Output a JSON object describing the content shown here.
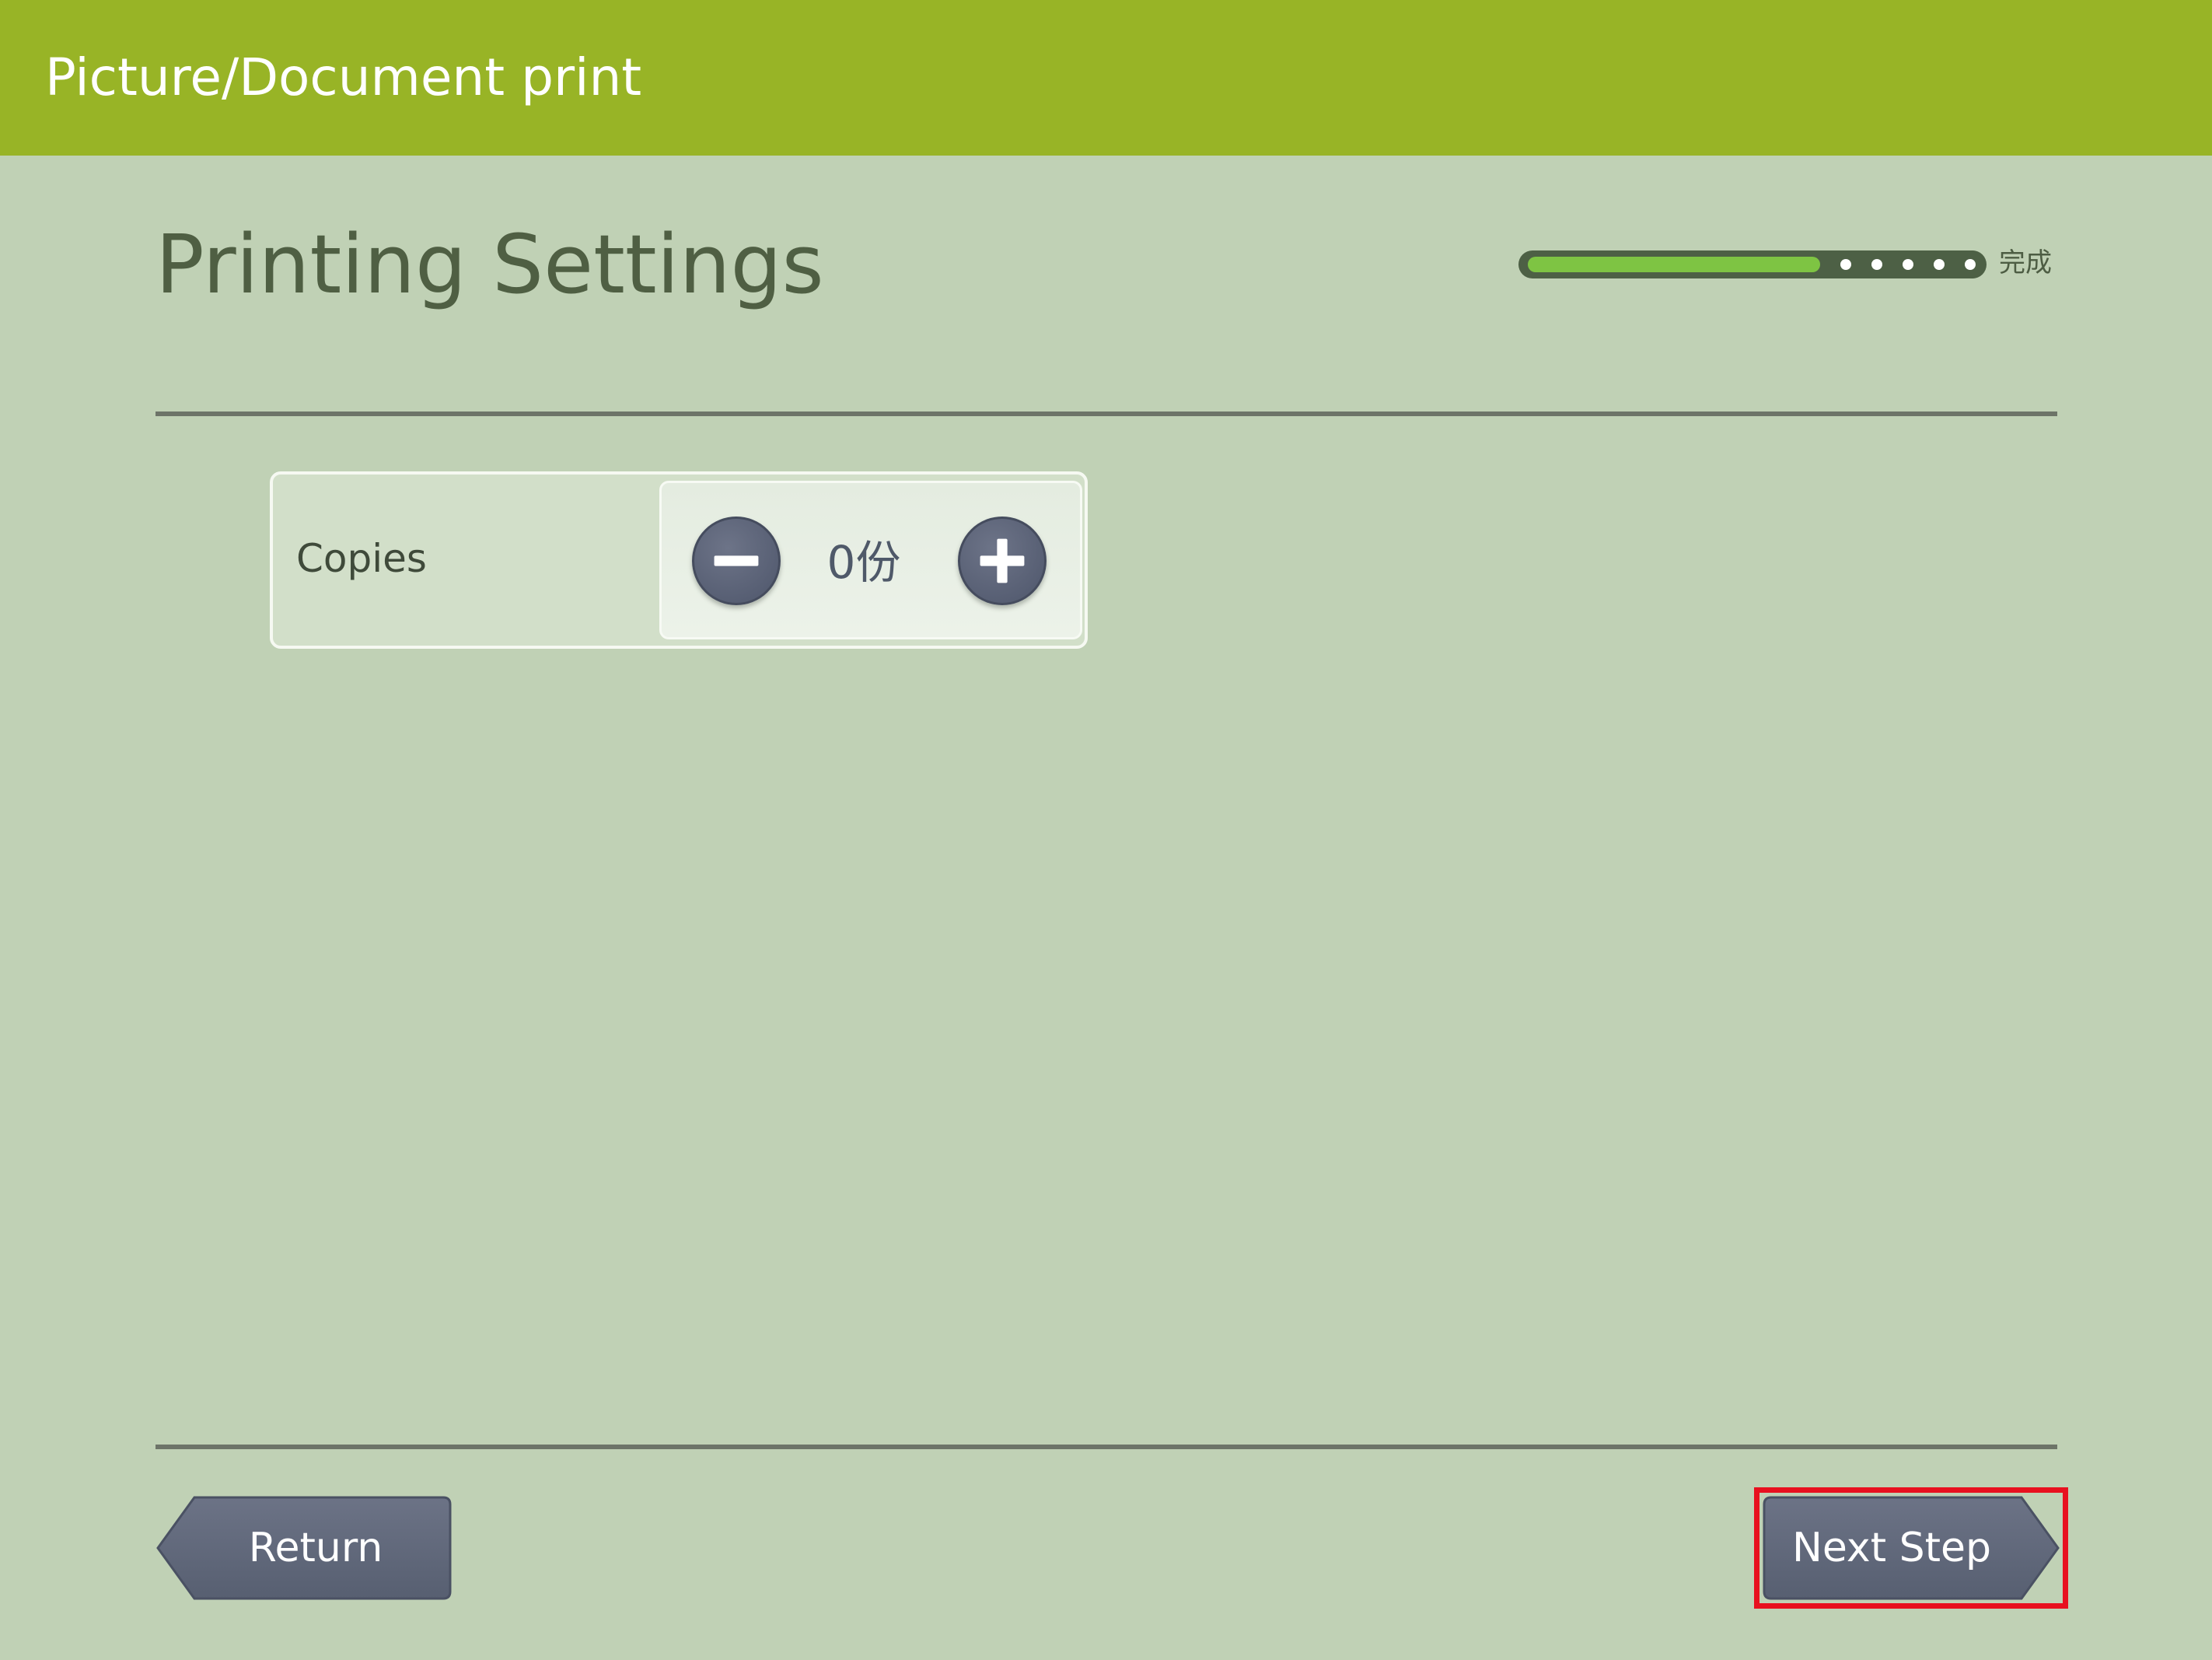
{
  "header": {
    "title": "Picture/Document print"
  },
  "page": {
    "title": "Printing Settings"
  },
  "progress": {
    "fraction": 0.5,
    "label": "完成"
  },
  "copies": {
    "label": "Copies",
    "value": "0份",
    "decrease_icon": "minus-icon",
    "increase_icon": "plus-icon"
  },
  "footer": {
    "return_label": "Return",
    "next_label": "Next Step"
  },
  "colors": {
    "header_bg": "#98b426",
    "page_bg": "#c0d1b5",
    "button_bg": "#5f6779",
    "progress_fill": "#7ec443",
    "highlight": "#e8101f"
  }
}
